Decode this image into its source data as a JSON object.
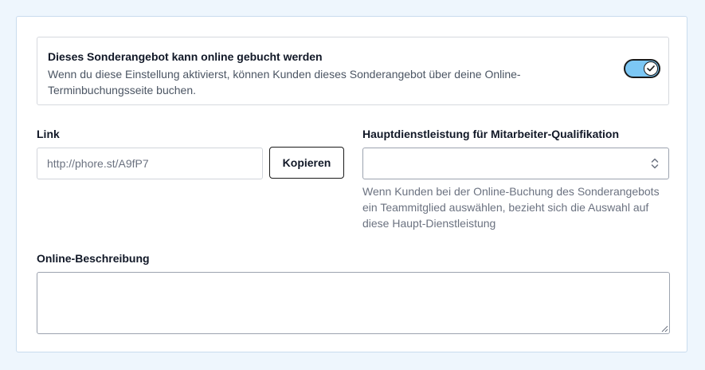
{
  "online_toggle": {
    "title": "Dieses Sonderangebot kann online gebucht werden",
    "description": "Wenn du diese Einstellung aktivierst, können Kunden dieses Sonderangebot über deine Online-Terminbuchungsseite buchen.",
    "enabled": true,
    "track_color": "#7cc7f4",
    "icon": "check-icon"
  },
  "link": {
    "label": "Link",
    "value": "http://phore.st/A9fP7",
    "copy_label": "Kopieren"
  },
  "main_service": {
    "label": "Hauptdienstleistung für Mitarbeiter-Qualifikation",
    "value": "",
    "icon": "chevron-up-down-icon",
    "help": "Wenn Kunden bei der Online-Buchung des Sonderangebots ein Teammitglied auswählen, bezieht sich die Auswahl auf diese Haupt-Dienstleistung"
  },
  "online_description": {
    "label": "Online-Beschreibung",
    "value": ""
  }
}
